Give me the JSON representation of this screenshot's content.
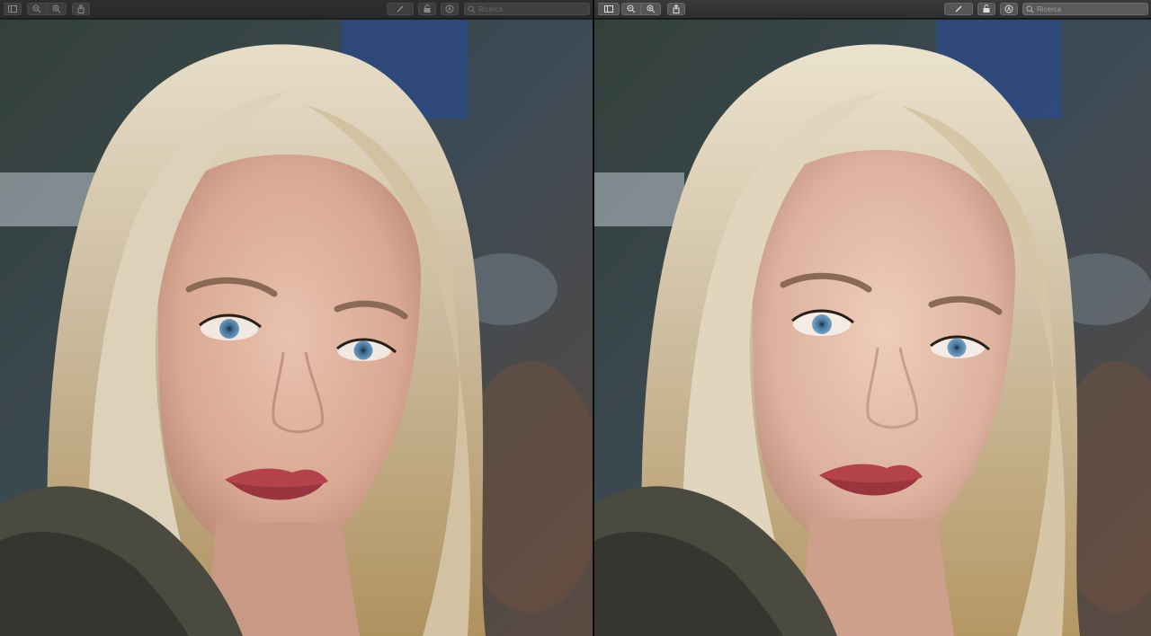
{
  "windows": [
    {
      "id": "left",
      "toolbar": {
        "icons": [
          "sidebar-icon",
          "zoom-out-icon",
          "zoom-in-icon",
          "share-icon",
          "markup-pen-icon",
          "rotate-icon",
          "annotate-icon",
          "search-icon"
        ],
        "search_placeholder": "Ricerca"
      },
      "photo": {
        "subject": "portrait-original"
      }
    },
    {
      "id": "right",
      "toolbar": {
        "icons": [
          "sidebar-icon",
          "zoom-out-icon",
          "zoom-in-icon",
          "share-icon",
          "markup-pen-icon",
          "rotate-icon",
          "annotate-icon",
          "search-icon"
        ],
        "search_placeholder": "Ricerca"
      },
      "photo": {
        "subject": "portrait-retouched"
      }
    }
  ],
  "colors": {
    "toolbar_bg": "#3a3a3a",
    "hair": "#d8cdb8",
    "skin": "#e2b9a4",
    "lips": "#b4424a",
    "eyes": "#5e8bb0",
    "fur": "#4a4a40",
    "background_blur": "#3d4a55"
  }
}
